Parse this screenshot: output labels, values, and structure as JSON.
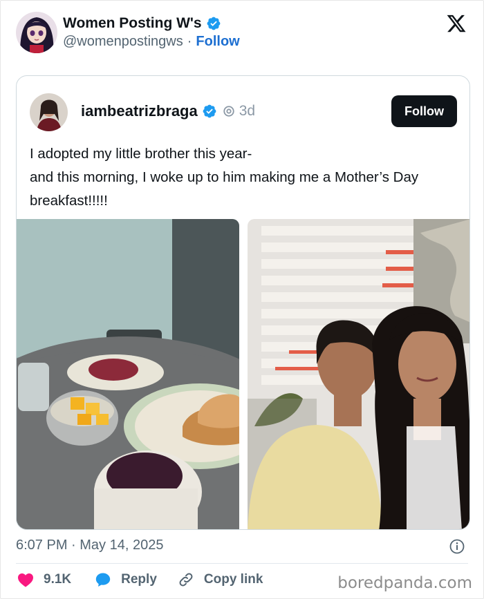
{
  "tweet": {
    "author_name": "Women Posting W's",
    "handle": "@womenpostingws",
    "separator": "·",
    "follow_label": "Follow",
    "timestamp": "6:07 PM · May 14, 2025",
    "likes": "9.1K",
    "reply_label": "Reply",
    "copy_link_label": "Copy link"
  },
  "quoted": {
    "author_name": "iambeatrizbraga",
    "age": "3d",
    "follow_label": "Follow",
    "text_line1": "I adopted my little brother this year-",
    "text_line2": "and this morning, I woke up to him making me a Mother’s Day breakfast!!!!!"
  },
  "watermark": "boredpanda.com",
  "colors": {
    "verified": "#1d9bf0",
    "follow_link": "#1d6fd1",
    "like_heart": "#f91880",
    "reply_bubble": "#1d9bf0",
    "button_dark": "#0f1419"
  },
  "icons": [
    "x-logo-icon",
    "verified-badge-icon",
    "threads-ring-icon",
    "info-icon",
    "heart-icon",
    "reply-bubble-icon",
    "link-icon"
  ]
}
